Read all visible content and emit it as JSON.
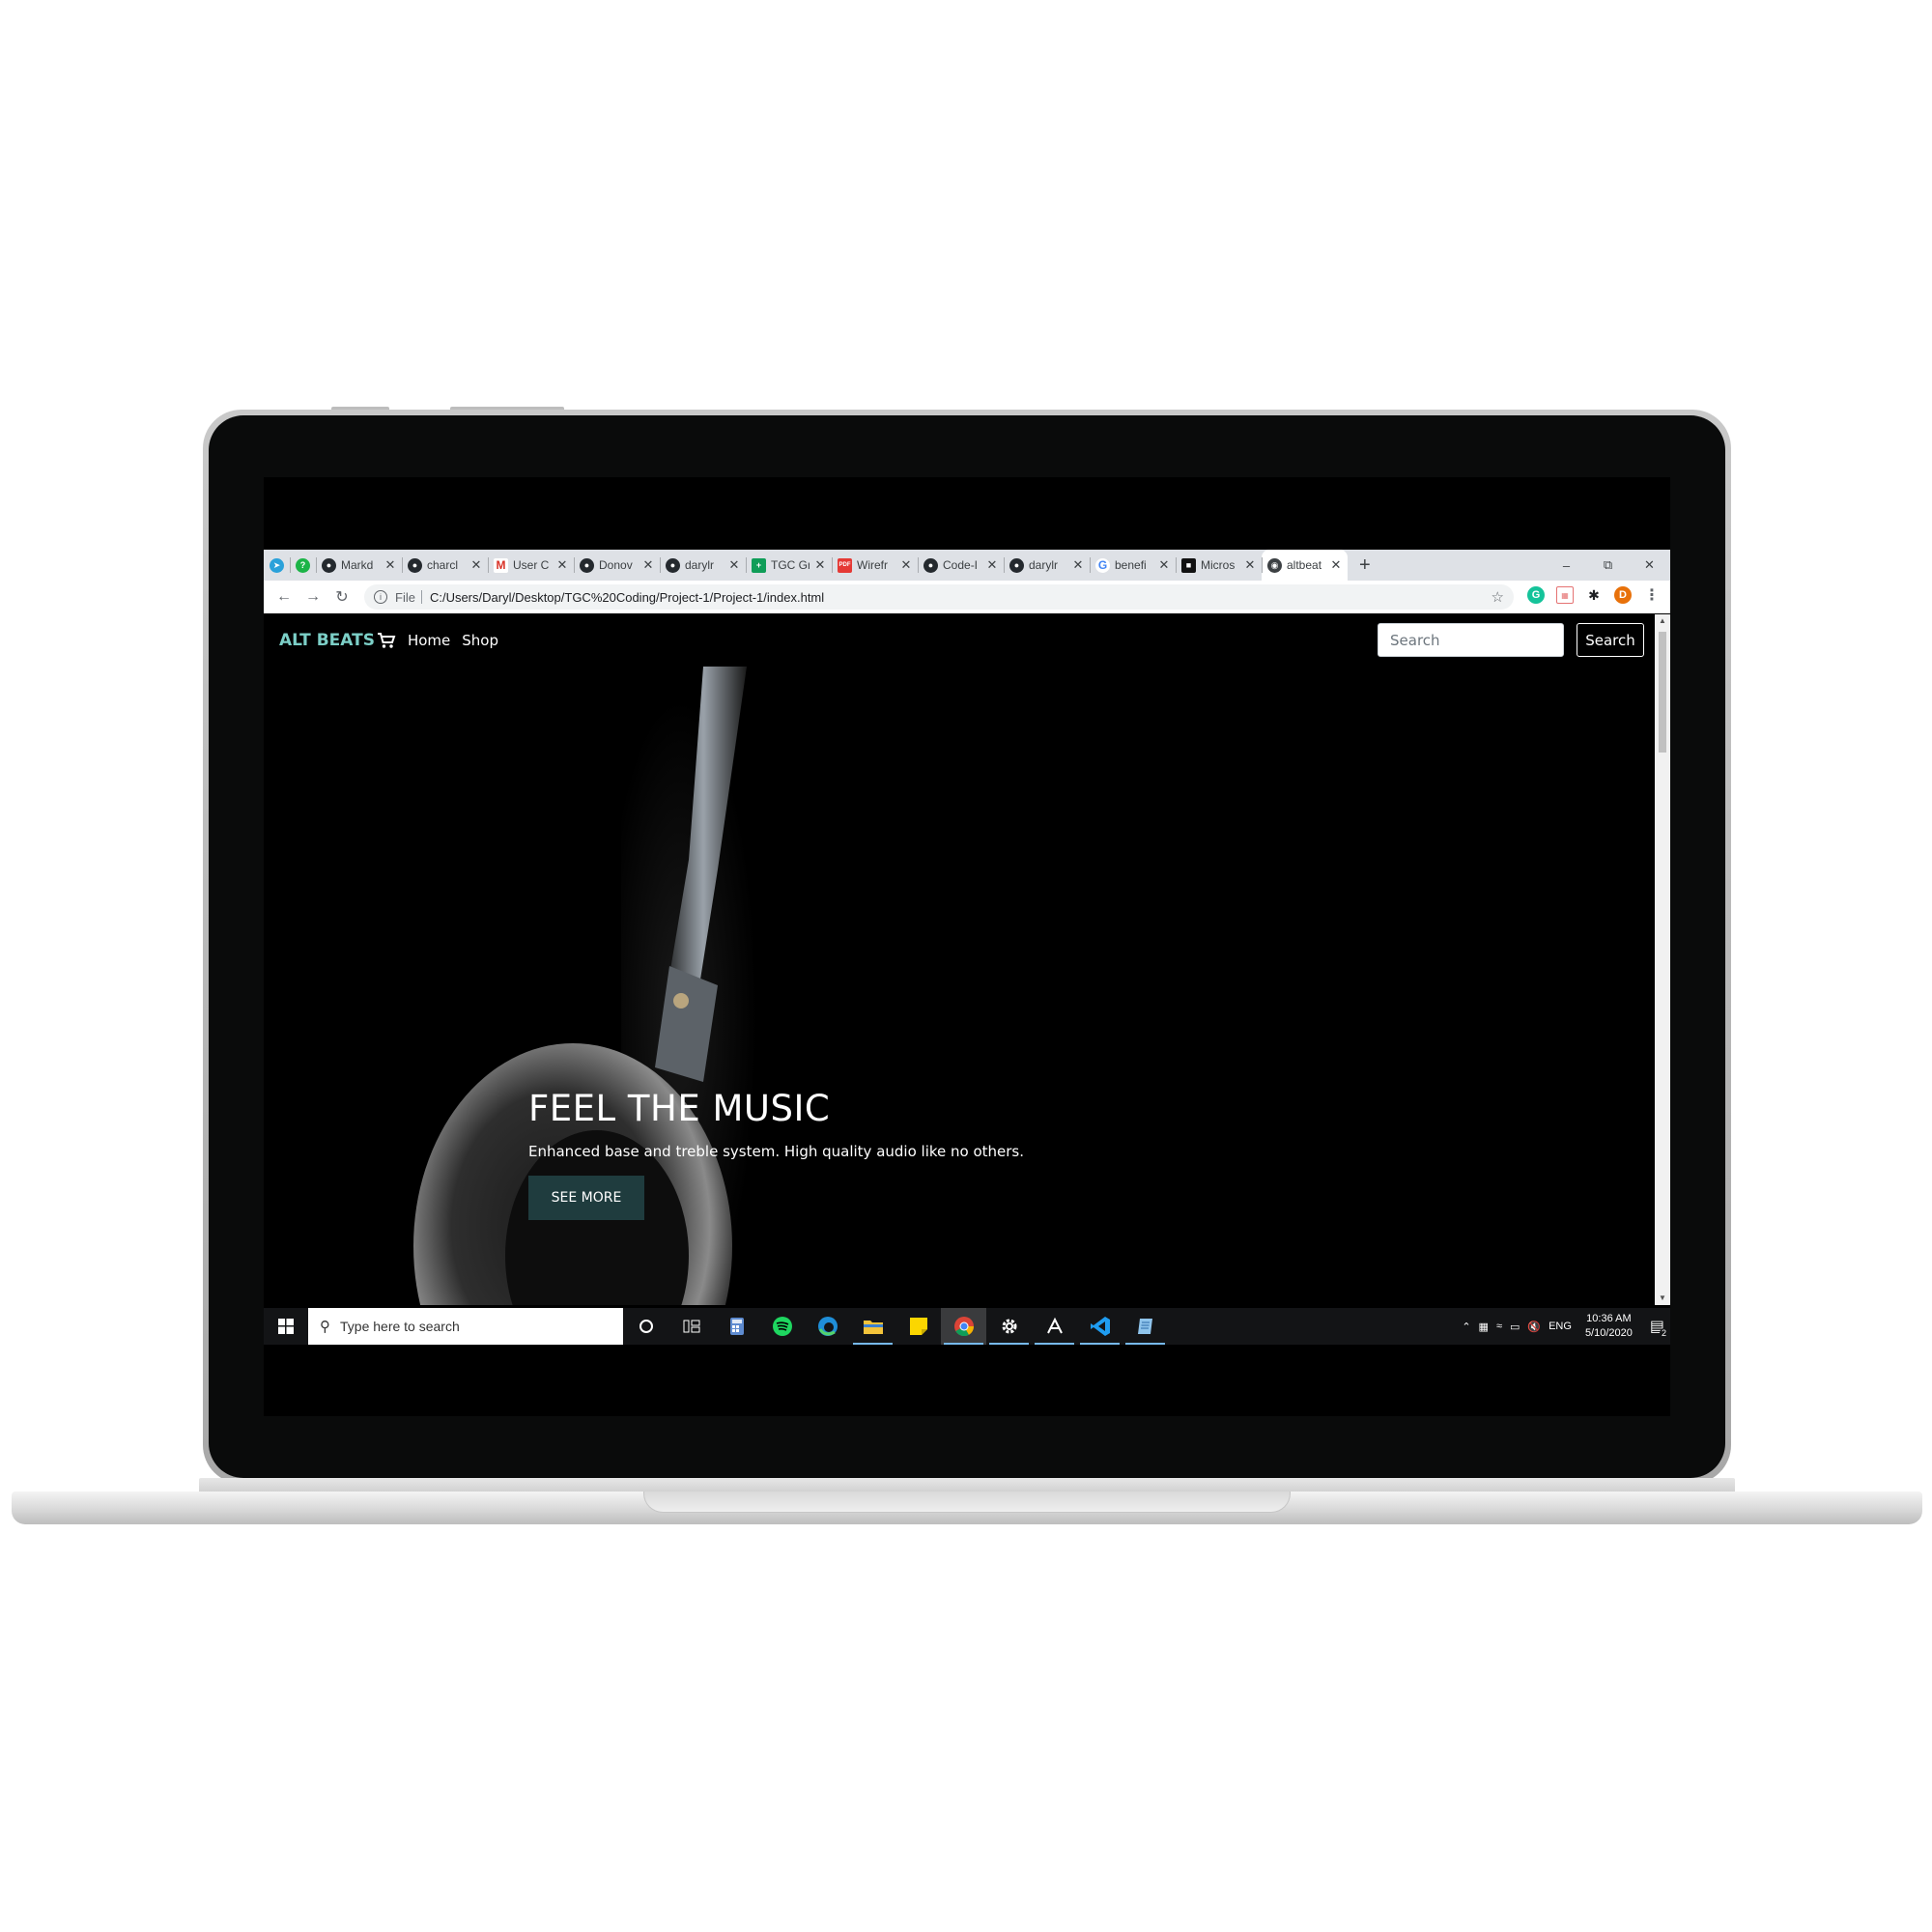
{
  "browser": {
    "tabs": [
      {
        "title": "",
        "favicon": "telegram-icon",
        "color": "#2aa1da"
      },
      {
        "title": "",
        "favicon": "whatsapp-icon",
        "color": "#1cb447"
      },
      {
        "title": "Markd",
        "favicon": "github-icon",
        "color": "#24292e"
      },
      {
        "title": "charcl",
        "favicon": "github-icon",
        "color": "#24292e"
      },
      {
        "title": "User C",
        "favicon": "gmail-icon",
        "color": "#d93025"
      },
      {
        "title": "Donov",
        "favicon": "github-icon",
        "color": "#24292e"
      },
      {
        "title": "darylr",
        "favicon": "github-icon",
        "color": "#24292e"
      },
      {
        "title": "TGC Gr",
        "favicon": "sheets-icon",
        "color": "#0f9d58"
      },
      {
        "title": "Wirefr",
        "favicon": "pdf-icon",
        "color": "#e53935"
      },
      {
        "title": "Code-I",
        "favicon": "github-icon",
        "color": "#24292e"
      },
      {
        "title": "darylr",
        "favicon": "github-icon",
        "color": "#24292e"
      },
      {
        "title": "benefi",
        "favicon": "google-icon",
        "color": "#4285f4"
      },
      {
        "title": "Micros",
        "favicon": "app-icon",
        "color": "#111111"
      },
      {
        "title": "altbeat",
        "favicon": "globe-icon",
        "color": "#3c4043",
        "active": true
      }
    ],
    "new_tab": "+",
    "window_controls": {
      "minimize": "–",
      "restore": "⧉",
      "close": "✕"
    },
    "address": {
      "scheme": "File",
      "url": "C:/Users/Daryl/Desktop/TGC%20Coding/Project-1/Project-1/index.html"
    },
    "profile_initial": "D"
  },
  "site": {
    "brand": "ALT BEATS",
    "nav": {
      "home": "Home",
      "shop": "Shop"
    },
    "search_placeholder": "Search",
    "search_button": "Search",
    "hero": {
      "title": "FEEL THE MUSIC",
      "subtitle": "Enhanced base and treble system. High quality audio like no others.",
      "button": "SEE MORE"
    }
  },
  "taskbar": {
    "search_placeholder": "Type here to search",
    "apps": [
      "cortana-icon",
      "task-view-icon",
      "calculator-icon",
      "spotify-icon",
      "edge-icon",
      "file-explorer-icon",
      "sticky-notes-icon",
      "chrome-icon",
      "settings-icon",
      "acrobat-icon",
      "vscode-icon",
      "notepad-icon"
    ],
    "tray": {
      "language": "ENG",
      "time": "10:36 AM",
      "date": "5/10/2020",
      "notifications": "2"
    }
  },
  "colors": {
    "brand": "#7ccfc7",
    "hero_button": "#1f3c3e"
  }
}
